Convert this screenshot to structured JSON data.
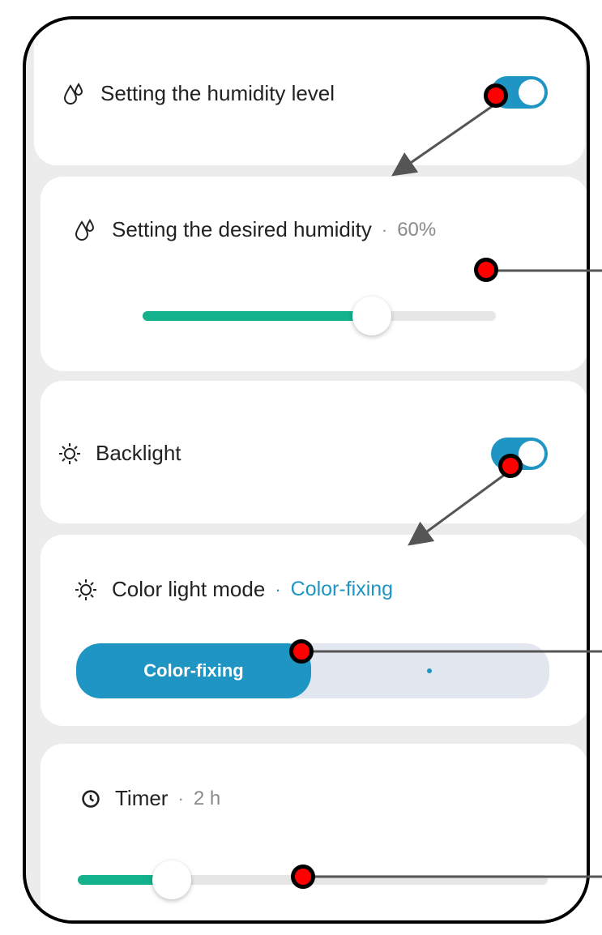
{
  "humidity_level": {
    "label": "Setting the humidity level",
    "icon": "droplets-icon",
    "toggle_on": true
  },
  "desired_humidity": {
    "label": "Setting the desired humidity",
    "separator": "·",
    "value": "60%",
    "icon": "droplets-icon",
    "slider_fraction": 0.65
  },
  "backlight": {
    "label": "Backlight",
    "icon": "sun-icon",
    "toggle_on": true
  },
  "color_light_mode": {
    "label": "Color light mode",
    "separator": "·",
    "value": "Color-fixing",
    "icon": "sun-icon",
    "options": [
      {
        "label": "Color-fixing",
        "selected": true
      },
      {
        "label": "",
        "selected": false
      }
    ]
  },
  "timer": {
    "label": "Timer",
    "separator": "·",
    "value": "2 h",
    "icon": "clock-icon",
    "slider_fraction": 0.2
  },
  "colors": {
    "accent_blue": "#1e95c3",
    "slider_green": "#14b28c",
    "marker_red": "#ff0000"
  }
}
